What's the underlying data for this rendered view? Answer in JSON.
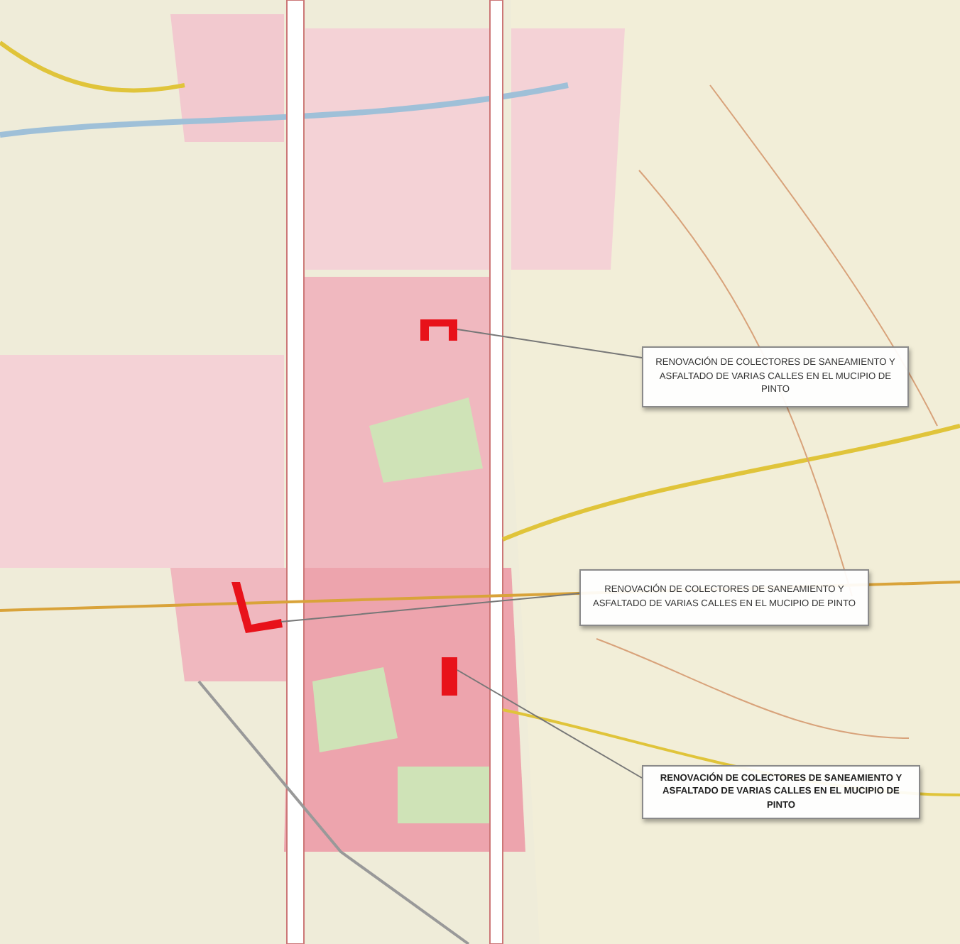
{
  "callouts": [
    {
      "text": "RENOVACIÓN DE COLECTORES DE SANEAMIENTO Y ASFALTADO DE VARIAS CALLES EN EL MUCIPIO DE PINTO",
      "bold": false
    },
    {
      "text": "RENOVACIÓN DE COLECTORES DE SANEAMIENTO Y ASFALTADO DE VARIAS CALLES EN EL MUCIPIO DE PINTO",
      "bold": false
    },
    {
      "text": "RENOVACIÓN DE COLECTORES DE SANEAMIENTO Y ASFALTADO DE VARIAS CALLES EN EL MUCIPIO DE PINTO",
      "bold": true
    }
  ]
}
